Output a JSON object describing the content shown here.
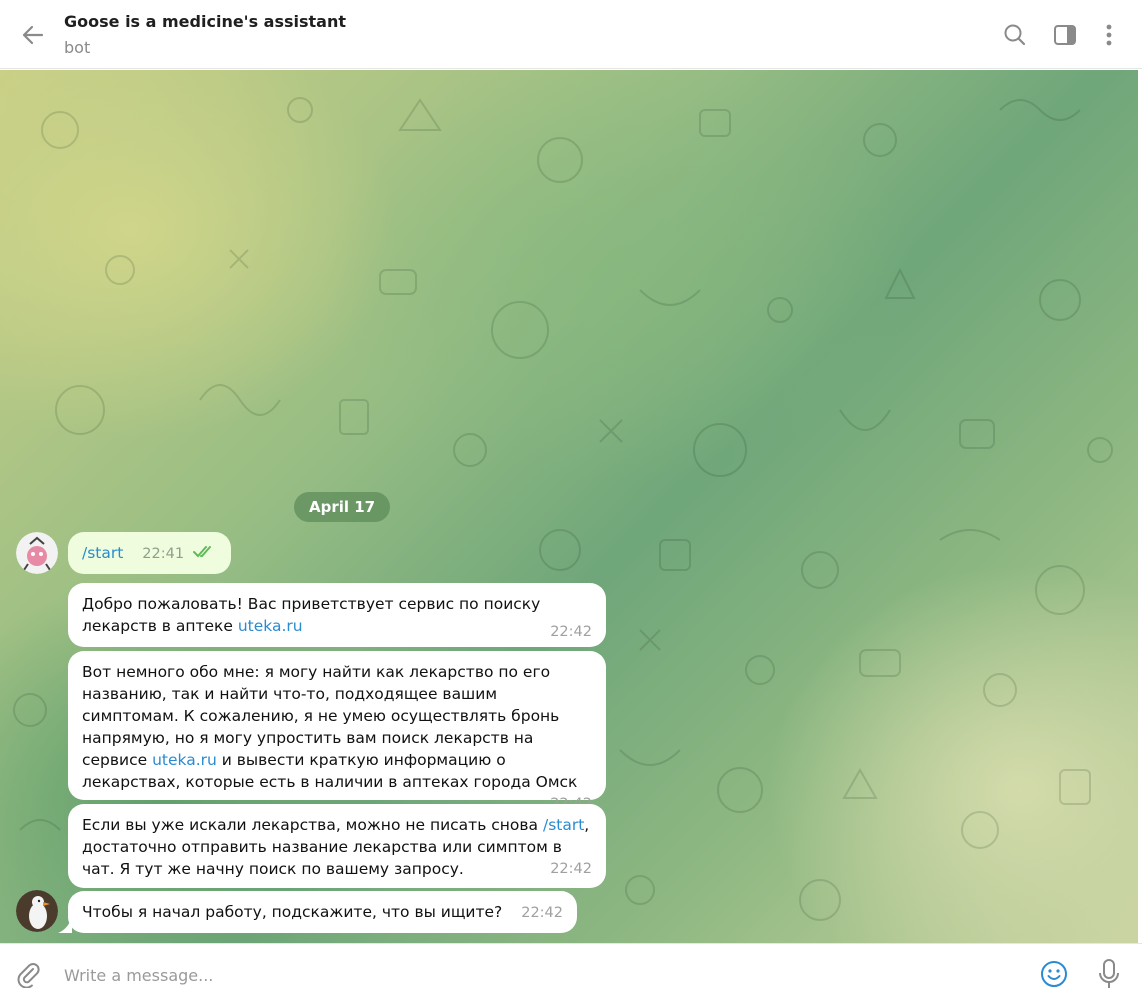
{
  "header": {
    "title": "Goose is a medicine's assistant",
    "subtitle": "bot",
    "icons": [
      "back-arrow-icon",
      "search-icon",
      "sidebar-toggle-icon",
      "more-vertical-icon"
    ]
  },
  "chat": {
    "date_badge": "April 17",
    "messages": [
      {
        "direction": "out",
        "text": "/start",
        "time": "22:41",
        "status": "read"
      },
      {
        "direction": "in",
        "parts": [
          "Добро пожаловать! Вас приветствует сервис по поиску лекарств в аптеке ",
          "uteka.ru"
        ],
        "time": "22:42"
      },
      {
        "direction": "in",
        "parts": [
          "Вот немного обо мне: я могу найти как лекарство по его названию, так и найти что-то, подходящее вашим симптомам. К сожалению, я не умею осуществлять бронь напрямую, но я могу упростить вам поиск лекарств на сервисе ",
          "uteka.ru",
          " и вывести краткую информацию о лекарствах, которые есть в наличии в аптеках города Омск"
        ],
        "time": "22:42"
      },
      {
        "direction": "in",
        "parts": [
          "Если вы уже искали лекарства, можно не писать снова ",
          "/start",
          ", достаточно отправить название лекарства или симптом в чат. Я тут же начну поиск по вашему запросу."
        ],
        "time": "22:42"
      },
      {
        "direction": "in",
        "text": "Чтобы я начал работу, подскажите, что вы ищите?",
        "time": "22:42"
      }
    ]
  },
  "composer": {
    "placeholder": "Write a message...",
    "icons": [
      "attach-icon",
      "emoji-icon",
      "microphone-icon"
    ]
  },
  "colors": {
    "accent": "#2a8bd0",
    "outgoing_bubble": "#effdde",
    "incoming_bubble": "#ffffff",
    "read_check": "#5fba5a",
    "icon_gray": "#8a8a8a"
  }
}
